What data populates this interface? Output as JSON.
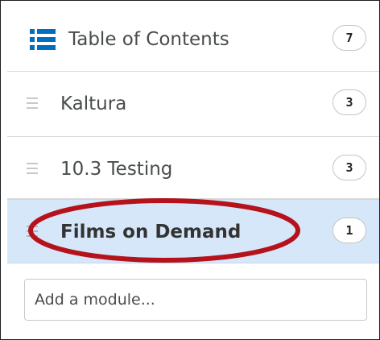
{
  "toc": {
    "title": "Table of Contents",
    "count": "7",
    "icon": "list-icon",
    "accent_color": "#006fbf"
  },
  "modules": [
    {
      "label": "Kaltura",
      "count": "3"
    },
    {
      "label": "10.3 Testing",
      "count": "3"
    },
    {
      "label": "Films on Demand",
      "count": "1",
      "selected": true
    }
  ],
  "add_module": {
    "placeholder": "Add a module..."
  },
  "annotation": {
    "shape": "ellipse",
    "color": "#b5121b"
  },
  "colors": {
    "selected_row": "#d6e7f9"
  }
}
